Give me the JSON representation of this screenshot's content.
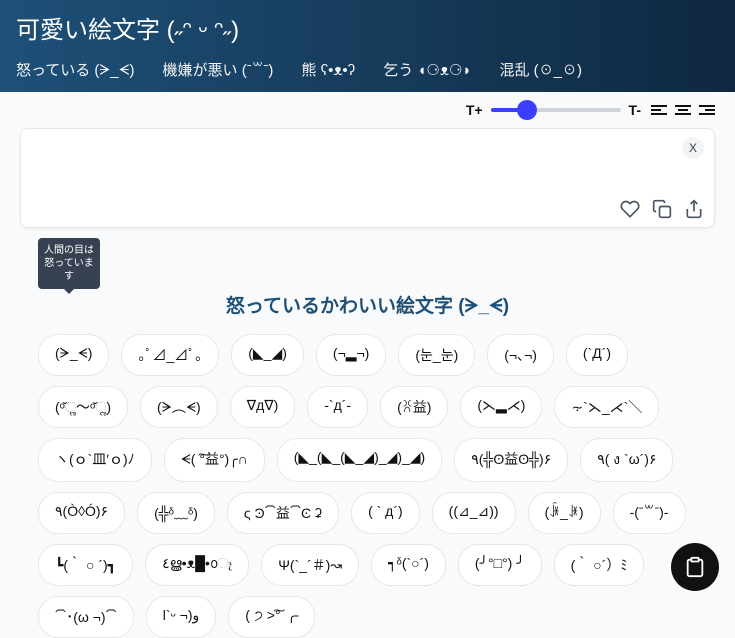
{
  "header": {
    "title": "可愛い絵文字 (˶ᵔ ᵕ ᵔ˶)",
    "tabs": [
      "怒っている (ᗒ_ᗕ)",
      "機嫌が悪い (ˉ꒳ˉ)",
      "熊 ʕ•ᴥ•ʔ",
      "乞う ◖⚆ᴥ⚆◗",
      "混乱 (☉_☉)"
    ]
  },
  "toolbar": {
    "tplus": "T+",
    "tminus": "T-"
  },
  "close_label": "X",
  "tooltip": "人間の目は怒っています",
  "section_title": "怒っているかわいい絵文字 (ᗒ_ᗕ)",
  "chips": [
    "(ᗒ_ᗕ)",
    "｡ﾟ⊿_⊿ﾟ｡",
    "(◣_◢)",
    "(¬▂¬)",
    "(눈_눈)",
    "(¬､¬)",
    "(`Д´)",
    "(ᵒ̌ૢ～ᵒ̌ૢ)",
    "(ᗒ︵ᗕ)",
    "∇д∇)",
    "-`д´-",
    "(ꐦ益)",
    "(⋋▂⋌)",
    "⸟`⋋_⋌`＼",
    "ヽ(ｏ`皿′ｏ)ﾉ",
    "ᗕ( ͠°益°)╭∩",
    "(◣_(◣_(◣_◢)_◢)_◢)",
    "٩(╬ʘ益ʘ╬)۶",
    "٩( ง `ω´)۶",
    "٩(Ò◊Ó)۶",
    "(╬ᵟ﹏ᵟ)",
    "ς Ͽ⏠益⏠Ͼ ʡ",
    "( ` д´)",
    "((⊿_⊿))",
    "(ꐁ_ꐂ)",
    "-(ˉ꒳ˉ)-",
    "┗(｀ ○ ´)┓",
    "٤ൠ•ᴥ█•൦ෑ",
    "Ψ(`_´＃)↝",
    "┑ᵟ(`○´)",
    "(╯°□°) ╯",
    "(｀ ○´）ﾐ",
    "⏠･(ω ¬)⏠",
    "l`ᵕ ¬)و",
    "( ੭ >͠° ╭"
  ]
}
